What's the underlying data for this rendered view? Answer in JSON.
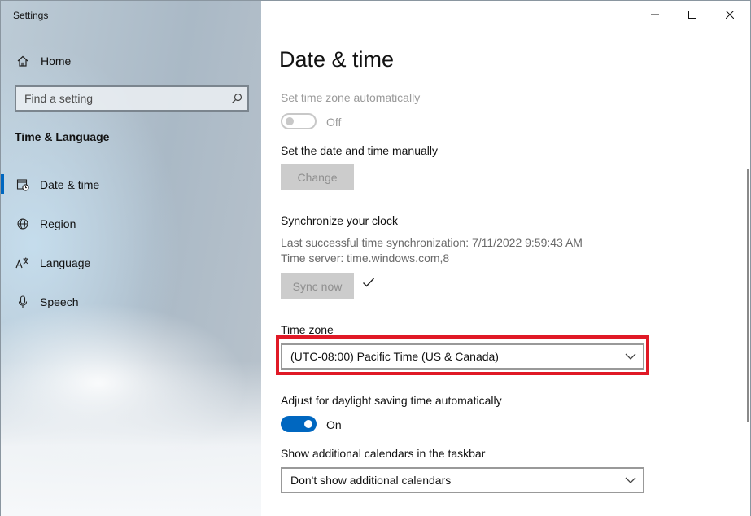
{
  "window": {
    "title": "Settings"
  },
  "sidebar": {
    "home_label": "Home",
    "search_placeholder": "Find a setting",
    "section_title": "Time & Language",
    "items": [
      {
        "label": "Date & time",
        "icon": "date-time-icon",
        "active": true
      },
      {
        "label": "Region",
        "icon": "globe-icon"
      },
      {
        "label": "Language",
        "icon": "language-icon"
      },
      {
        "label": "Speech",
        "icon": "microphone-icon"
      }
    ]
  },
  "main": {
    "title": "Date & time",
    "auto_timezone": {
      "label": "Set time zone automatically",
      "state_text": "Off",
      "enabled": false
    },
    "manual": {
      "label": "Set the date and time manually",
      "button_label": "Change"
    },
    "sync": {
      "label": "Synchronize your clock",
      "last_sync": "Last successful time synchronization: 7/11/2022 9:59:43 AM",
      "server": "Time server: time.windows.com,8",
      "button_label": "Sync now"
    },
    "timezone": {
      "label": "Time zone",
      "value": "(UTC-08:00) Pacific Time (US & Canada)"
    },
    "daylight": {
      "label": "Adjust for daylight saving time automatically",
      "state_text": "On",
      "enabled": true
    },
    "calendars": {
      "label": "Show additional calendars in the taskbar",
      "value": "Don't show additional calendars"
    }
  },
  "colors": {
    "accent": "#0067c0",
    "highlight": "#e01926"
  }
}
